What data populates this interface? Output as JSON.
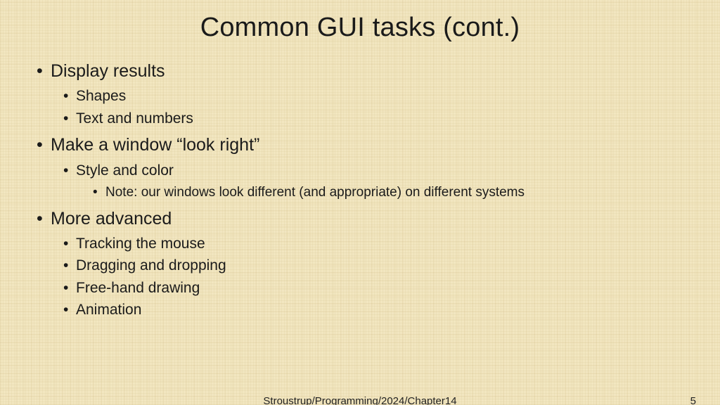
{
  "title": "Common GUI tasks (cont.)",
  "bullets": [
    {
      "text": "Display results",
      "children": [
        {
          "text": "Shapes"
        },
        {
          "text": "Text and numbers"
        }
      ]
    },
    {
      "text": "Make a window “look right”",
      "children": [
        {
          "text": "Style and color",
          "children": [
            {
              "text": "Note: our windows look different (and appropriate) on different systems"
            }
          ]
        }
      ]
    },
    {
      "text": "More advanced",
      "children": [
        {
          "text": "Tracking the mouse"
        },
        {
          "text": "Dragging and dropping"
        },
        {
          "text": "Free-hand drawing"
        },
        {
          "text": "Animation"
        }
      ]
    }
  ],
  "footer": {
    "center": "Stroustrup/Programming/2024/Chapter14",
    "page": "5"
  }
}
